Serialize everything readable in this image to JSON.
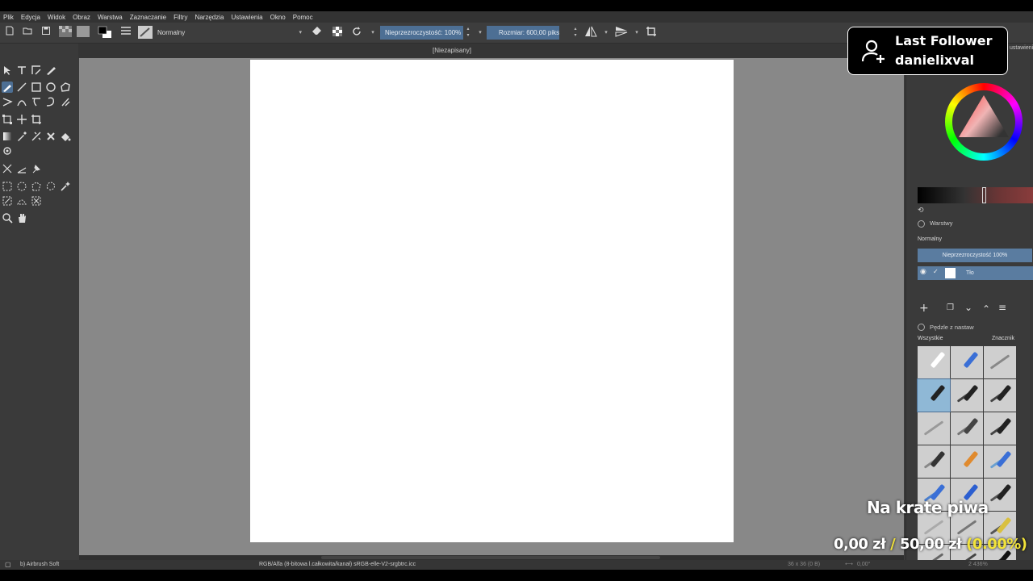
{
  "menu": [
    "Plik",
    "Edycja",
    "Widok",
    "Obraz",
    "Warstwa",
    "Zaznaczanie",
    "Filtry",
    "Narzędzia",
    "Ustawienia",
    "Okno",
    "Pomoc"
  ],
  "toolbar": {
    "blend_mode": "Normalny",
    "opacity_label": "Nieprzezroczystość: 100%",
    "size_label": "Rozmiar: 600,00 piks"
  },
  "document": {
    "title": "[Niezapisany]"
  },
  "dock": {
    "top_partial": "ustawieni",
    "layers_title": "Warstwy",
    "layers_blend": "Normalny",
    "layers_opacity": "Nieprzezroczystość  100%",
    "layer_name": "Tło",
    "brushes_title": "Pędzle z nastaw",
    "brushes_filter": "Wszystkie",
    "brushes_tag": "Znacznik"
  },
  "status": {
    "brush": "b) Airbrush Soft",
    "color_info": "RGB/Alfa (8-bitowa l.całkowita/kanał)  sRGB-elle-V2-srgbtrc.icc",
    "dims": "36 x 36 (0 B)",
    "angle": "0,00°",
    "zoom": "2 436%"
  },
  "overlay": {
    "follower_label": "Last Follower",
    "follower_name": "danielixval",
    "donation_title": "Na krate piwa",
    "donation_current": "0,00 zł",
    "donation_sep": "/",
    "donation_goal": "50,00 zł",
    "donation_pct": "(0.00%)"
  },
  "colors": {
    "accent": "#4d6f94",
    "highlight": "#f2e33a"
  }
}
